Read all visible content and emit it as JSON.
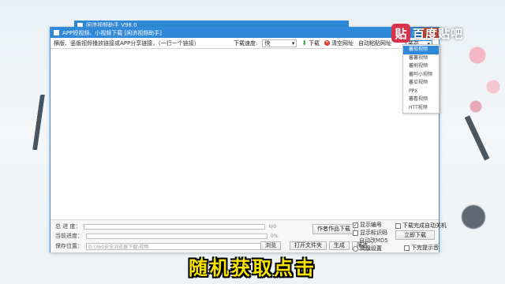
{
  "background_window": {
    "title": "闲济视频助手  V98.0"
  },
  "window": {
    "title": "APP短视频、小视频下载 [闲济视频助手]",
    "controls": {
      "minimize": "—",
      "maximize": "□",
      "close": "✕"
    }
  },
  "toolbar": {
    "hint": "横版、竖版视频播放链接或APP分享链接，（一行一个链接）",
    "speed_label": "下载速度:",
    "speed_value": "快",
    "download_label": "下载",
    "clear_label": "清空网址",
    "auto_paste_label": "自动粘贴网址",
    "source_select": "蕃茄"
  },
  "source_dropdown": {
    "options": [
      "蕃茄视频",
      "蕃薯视频",
      "蕃刷视频",
      "蕃阿小视频",
      "蕃瓜视频",
      "PPX",
      "蕃看视频",
      "HTT视频"
    ],
    "selected_index": 0
  },
  "bottom": {
    "total_progress_label": "总 进 度：",
    "total_progress_value": "0/0",
    "current_progress_label": "当前进度：",
    "current_progress_value": "0%",
    "save_path_label": "保存位置：",
    "save_path_value": "D:\\360安全浏览器下载\\视频",
    "browse_label": "浏览",
    "open_folder_label": "打开文件夹",
    "generate_label": "生成",
    "select_label": "筛选",
    "works_download_label": "作者作品下载",
    "show_title_label": "显示编号",
    "show_title_checked": true,
    "show_watermark_label": "显示标识码",
    "auto_shutdown_label": "自动改MD5",
    "advanced_label": "高级设置",
    "shutdown_after_label": "下载完成自动关机",
    "download_now_label": "立即下载",
    "complete_sound_label": "下完提示音"
  },
  "overlay": {
    "logo_badge": "贴",
    "logo_text": "百度贴吧",
    "subtitle": "随机获取点击"
  }
}
